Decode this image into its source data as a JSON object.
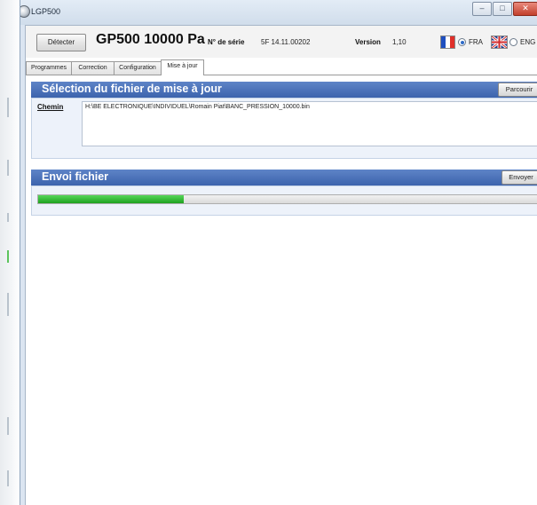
{
  "window": {
    "title": "LGP500",
    "minimize_glyph": "–",
    "maximize_glyph": "□",
    "close_glyph": "✕"
  },
  "header": {
    "detect_button": "Détecter",
    "model": "GP500 10000 Pa",
    "serial_label": "N° de série",
    "serial_value": "5F 14.11.00202",
    "version_label": "Version",
    "version_value": "1,10",
    "lang_fra": "FRA",
    "lang_eng": "ENG",
    "selected_lang": "FRA",
    "flag_colors": {
      "fr_blue": "#1f4fbf",
      "fr_white": "#ffffff",
      "fr_red": "#e0302a"
    }
  },
  "tabs": [
    {
      "label": "Programmes",
      "active": false
    },
    {
      "label": "Correction",
      "active": false
    },
    {
      "label": "Configuration",
      "active": false
    },
    {
      "label": "Mise à jour",
      "active": true
    }
  ],
  "selection_panel": {
    "title": "Sélection du fichier de mise à jour",
    "browse_button": "Parcourir",
    "path_label": "Chemin",
    "path_value": "H:\\BE ELECTRONIQUE\\INDIVIDUEL\\Romain Piat\\BANC_PRESSION_10000.bin"
  },
  "send_panel": {
    "title": "Envoi fichier",
    "send_button": "Envoyer",
    "progress": 0.29
  },
  "colors": {
    "panel_header": "#3c63ad",
    "progress_green": "#1ea21f",
    "panel_body": "#edf2fa"
  }
}
